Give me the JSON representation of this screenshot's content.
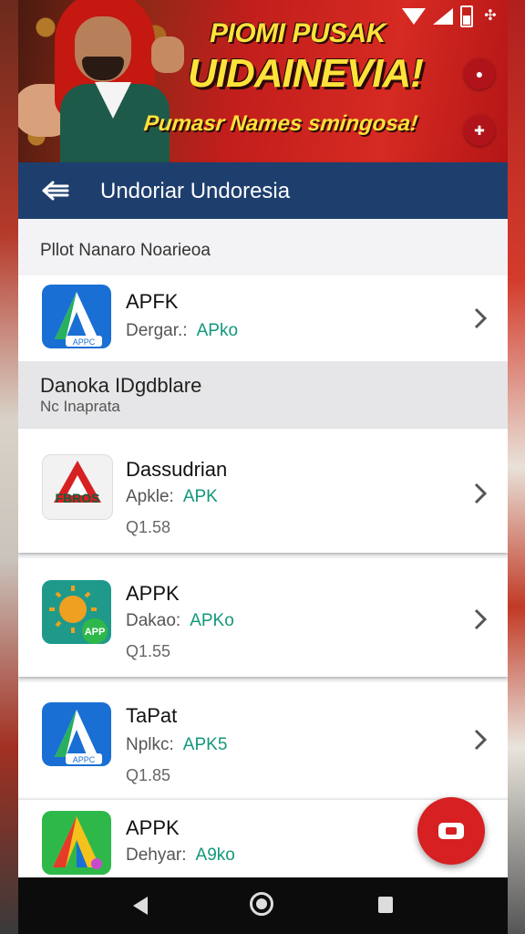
{
  "banner": {
    "title_line1": "PIOMI PUSAK",
    "title_line2": "UIDAINEVIA!",
    "subtitle": "Pumasr Names smingosa!"
  },
  "app_bar": {
    "title": "Undoriar Undoresia"
  },
  "header": {
    "text": "Pllot Nanaro Noarieoa"
  },
  "featured_app": {
    "name": "APFK",
    "meta_label": "Dergar.:",
    "meta_tag": "APko",
    "icon_label": "APPC",
    "icon": "apk-a-logo-icon"
  },
  "section": {
    "title": "Danoka IDgdblare",
    "subtitle": "Nc Inaprata"
  },
  "apps": [
    {
      "name": "Dassudrian",
      "meta_label": "Apkle:",
      "meta_tag": "APK",
      "size": "Q1.58",
      "icon_label": "FBROS",
      "icon": "red-triangle-logo-icon"
    },
    {
      "name": "APPK",
      "meta_label": "Dakao:",
      "meta_tag": "APKo",
      "size": "Q1.55",
      "icon_label": "APP",
      "icon": "sun-logo-icon"
    },
    {
      "name": "TaPat",
      "meta_label": "Nplkc:",
      "meta_tag": "APK5",
      "size": "Q1.85",
      "icon_label": "APPC",
      "icon": "apk-a-logo-icon"
    },
    {
      "name": "APPK",
      "meta_label": "Dehyar:",
      "meta_tag": "A9ko",
      "icon": "colorful-a-logo-icon"
    }
  ],
  "colors": {
    "app_bar": "#1e3f6e",
    "accent_tag": "#12987a",
    "fab": "#d62022",
    "banner_text": "#ffe23a"
  }
}
